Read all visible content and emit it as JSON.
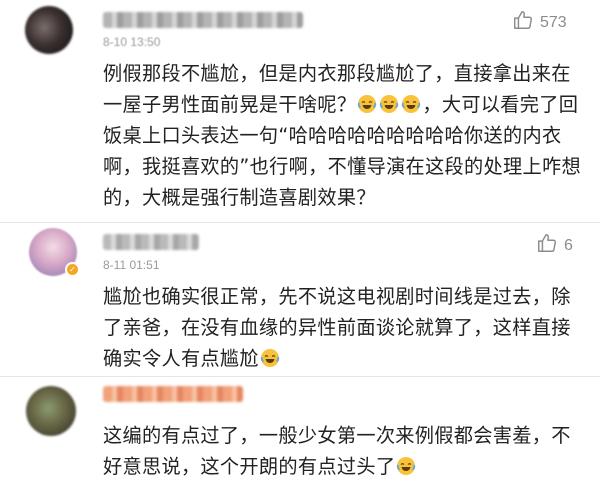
{
  "comments": [
    {
      "time": "8-10 13:50",
      "likes": "573",
      "text": "例假那段不尴尬，但是内衣那段尴尬了，直接拿出来在一屋子男性面前晃是干啥呢？",
      "text_tail": "，大可以看完了回饭桌上口头表达一句“哈哈哈哈哈哈哈哈哈你送的内衣啊，我挺喜欢的”也行啊，不懂导演在这段的处理上咋想的，大概是强行制造喜剧效果？"
    },
    {
      "time": "8-11 01:51",
      "likes": "6",
      "text": "尴尬也确实很正常，先不说这电视剧时间线是过去，除了亲爸，在没有血缘的异性前面谈论就算了，这样直接确实令人有点尴尬"
    },
    {
      "text": "这编的有点过了，一般少女第一次来例假都会害羞，不好意思说，这个开朗的有点过头了"
    }
  ],
  "icons": {
    "like": "thumbs-up-icon",
    "emoji": "laughing-tears-icon",
    "verified": "verified-badge-icon"
  },
  "colors": {
    "text": "#222222",
    "meta": "#9a9a9a",
    "divider": "#e6e6e6",
    "emoji_face": "#f8c33a",
    "emoji_tear": "#5aa9e6"
  }
}
